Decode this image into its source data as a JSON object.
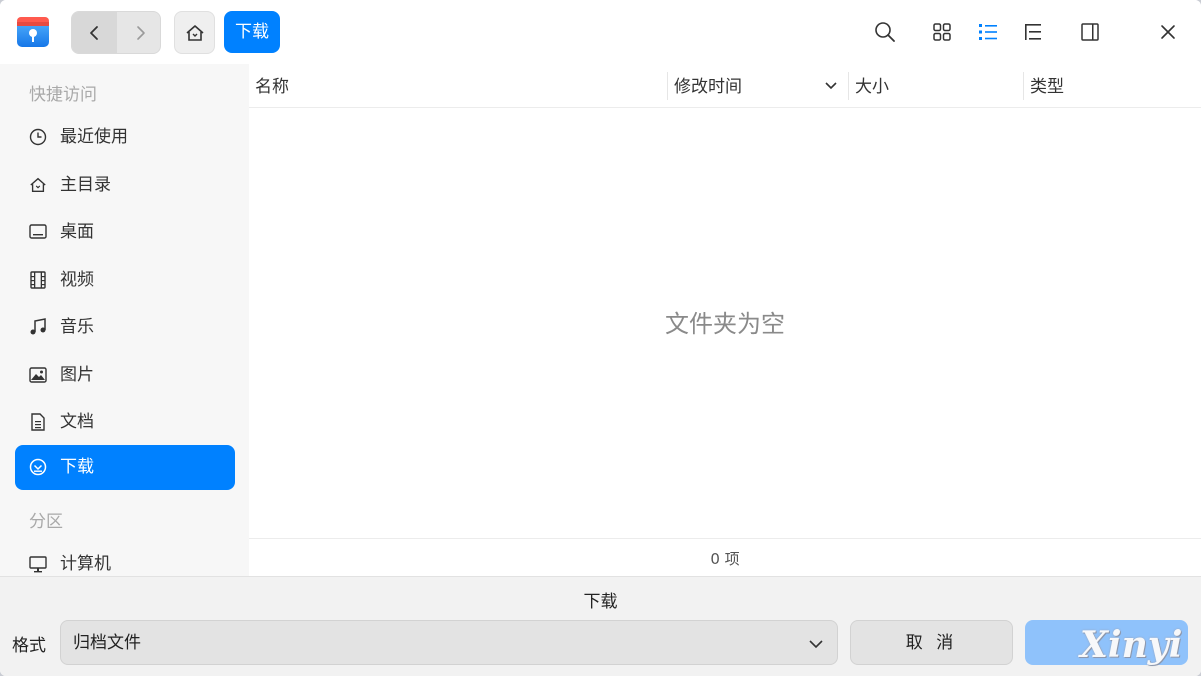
{
  "titlebar": {
    "breadcrumb": "下载",
    "icons": [
      "search-icon",
      "grid-view-icon",
      "list-view-icon",
      "tree-view-icon",
      "detail-panel-icon",
      "close-icon"
    ]
  },
  "sidebar": {
    "group_quick": "快捷访问",
    "items": [
      {
        "label": "最近使用",
        "icon": "clock-icon"
      },
      {
        "label": "主目录",
        "icon": "home-icon"
      },
      {
        "label": "桌面",
        "icon": "desktop-icon"
      },
      {
        "label": "视频",
        "icon": "film-icon"
      },
      {
        "label": "音乐",
        "icon": "music-icon"
      },
      {
        "label": "图片",
        "icon": "image-icon"
      },
      {
        "label": "文档",
        "icon": "document-icon"
      },
      {
        "label": "下载",
        "icon": "download-icon"
      }
    ],
    "group_partition": "分区",
    "partition_items": [
      {
        "label": "计算机",
        "icon": "computer-icon"
      }
    ],
    "active_index": 7
  },
  "columns": {
    "name": "名称",
    "modified": "修改时间",
    "size": "大小",
    "type": "类型"
  },
  "main": {
    "empty_text": "文件夹为空",
    "status": "0 项"
  },
  "bottom": {
    "filename": "下载",
    "format_label": "格式",
    "format_value": "归档文件",
    "cancel_label": "取 消",
    "watermark": "Xinyi"
  },
  "colors": {
    "accent": "#0081ff",
    "save_disabled": "#8fc2fb"
  }
}
